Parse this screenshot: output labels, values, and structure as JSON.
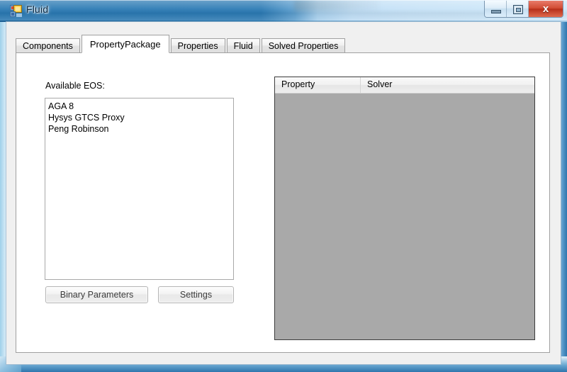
{
  "window": {
    "title": "Fluid",
    "icon": "vs-form-icon",
    "controls": [
      {
        "name": "minimize",
        "glyph": "minimize-icon"
      },
      {
        "name": "maximize",
        "glyph": "maximize-icon"
      },
      {
        "name": "close",
        "glyph": "close-icon",
        "label": "x"
      }
    ]
  },
  "tabs": [
    {
      "label": "Components",
      "active": false
    },
    {
      "label": "PropertyPackage",
      "active": true
    },
    {
      "label": "Properties",
      "active": false
    },
    {
      "label": "Fluid",
      "active": false
    },
    {
      "label": "Solved Properties",
      "active": false
    }
  ],
  "panel": {
    "eos_label": "Available EOS:",
    "eos_items": [
      "AGA 8",
      "Hysys GTCS Proxy",
      "Peng Robinson"
    ],
    "buttons": {
      "binary_parameters": "Binary Parameters",
      "settings": "Settings"
    }
  },
  "grid": {
    "columns": [
      "Property",
      "Solver"
    ],
    "rows": []
  },
  "colors": {
    "titlebar_blue": "#2a79b3",
    "titlebar_glass": "#cfe8f9",
    "close_red": "#d24d35",
    "grid_empty_gray": "#a9a9a9",
    "control_face": "#f0f0f0"
  }
}
